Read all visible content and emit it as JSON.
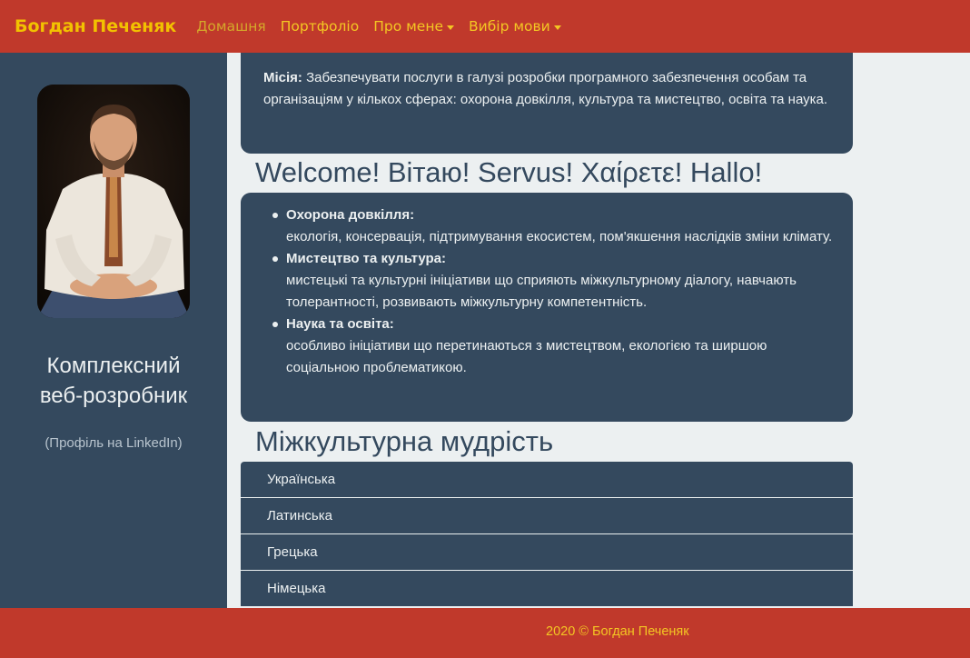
{
  "navbar": {
    "brand": "Богдан Печеняк",
    "links": [
      {
        "label": "Домашня"
      },
      {
        "label": "Портфоліо"
      },
      {
        "label": "Про мене"
      },
      {
        "label": "Вибір мови"
      }
    ]
  },
  "sidebar": {
    "photo_alt": "portrait-photo",
    "title_line1": "Комплексний",
    "title_line2": "веб-розробник",
    "profile_link": "(Профіль на LinkedIn)"
  },
  "mission": {
    "label": "Місія:",
    "text": " Забезпечувати послуги в галузі розробки програмного забезпечення особам та організаціям у кількох сферах: охорона довкілля, культура та мистецтво, освіта та наука."
  },
  "welcome": {
    "heading": "Welcome! Вітаю! Servus! Χαίρετε! Hallo!"
  },
  "areas": [
    {
      "title": "Охорона довкілля:",
      "desc": "екологія, консервація, підтримування екосистем, пом'якшення наслідків зміни клімату."
    },
    {
      "title": "Мистецтво та культура:",
      "desc": "мистецькі та культурні ініціативи що сприяють міжкультурному діалогу, навчають толерантності, розвивають міжкультурну компетентність."
    },
    {
      "title": "Наука та освіта:",
      "desc": "особливо ініціативи що перетинаються з мистецтвом, екологією та ширшою соціальною проблематикою."
    }
  ],
  "wisdom": {
    "heading": "Міжкультурна мудрість",
    "items": [
      {
        "label": "Українська"
      },
      {
        "label": "Латинська"
      },
      {
        "label": "Грецька"
      },
      {
        "label": "Німецька"
      }
    ]
  },
  "footer": {
    "text": "2020 © Богдан Печеняк"
  },
  "colors": {
    "navbar": "#c0392b",
    "sidebar": "#34495e",
    "accent": "#f3c623",
    "background": "#ecf0f1"
  }
}
